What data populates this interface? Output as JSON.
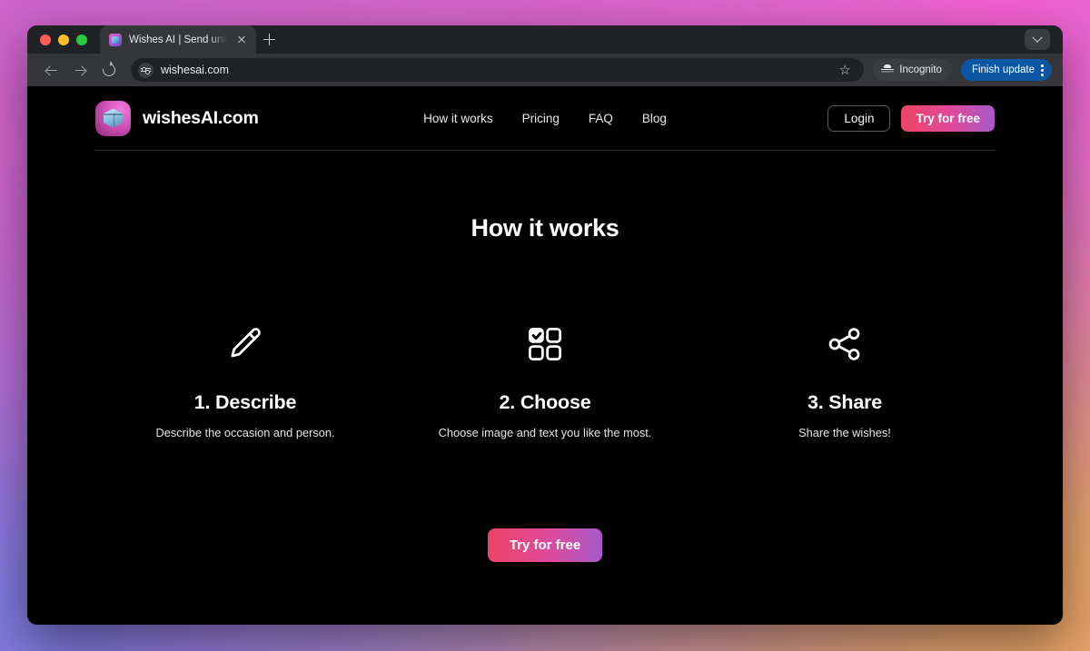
{
  "browser": {
    "traffic_lights": [
      "close",
      "minimize",
      "maximize"
    ],
    "tab": {
      "title": "Wishes AI | Send unique wish",
      "favicon_icon": "wishes-ai-favicon",
      "close_icon": "close-icon"
    },
    "new_tab_icon": "plus-icon",
    "tab_list_icon": "chevron-down-icon",
    "back_icon": "arrow-left-icon",
    "forward_icon": "arrow-right-icon",
    "reload_icon": "reload-icon",
    "omnibox": {
      "site_settings_icon": "tune-icon",
      "url": "wishesai.com",
      "bookmark_icon": "star-icon"
    },
    "incognito": {
      "label": "Incognito",
      "icon": "incognito-icon"
    },
    "update": {
      "label": "Finish update",
      "menu_icon": "kebab-menu-icon",
      "color": "#0b57a4"
    }
  },
  "site": {
    "brand": {
      "name": "wishesAI.com",
      "logo_icon": "gift-cube-logo"
    },
    "nav": [
      {
        "label": "How it works"
      },
      {
        "label": "Pricing"
      },
      {
        "label": "FAQ"
      },
      {
        "label": "Blog"
      }
    ],
    "actions": {
      "login_label": "Login",
      "cta_label": "Try for free"
    },
    "page_title": "How it works",
    "steps": [
      {
        "icon": "pencil-icon",
        "title": "1. Describe",
        "desc": "Describe the occasion and person."
      },
      {
        "icon": "grid-check-icon",
        "title": "2. Choose",
        "desc": "Choose image and text you like the most."
      },
      {
        "icon": "share-icon",
        "title": "3. Share",
        "desc": "Share the wishes!"
      }
    ],
    "bottom_cta_label": "Try for free",
    "colors": {
      "background": "#000000",
      "cta_gradient_start": "#ec4464",
      "cta_gradient_end": "#a659c8",
      "brand_pink": "#d152b8"
    }
  }
}
